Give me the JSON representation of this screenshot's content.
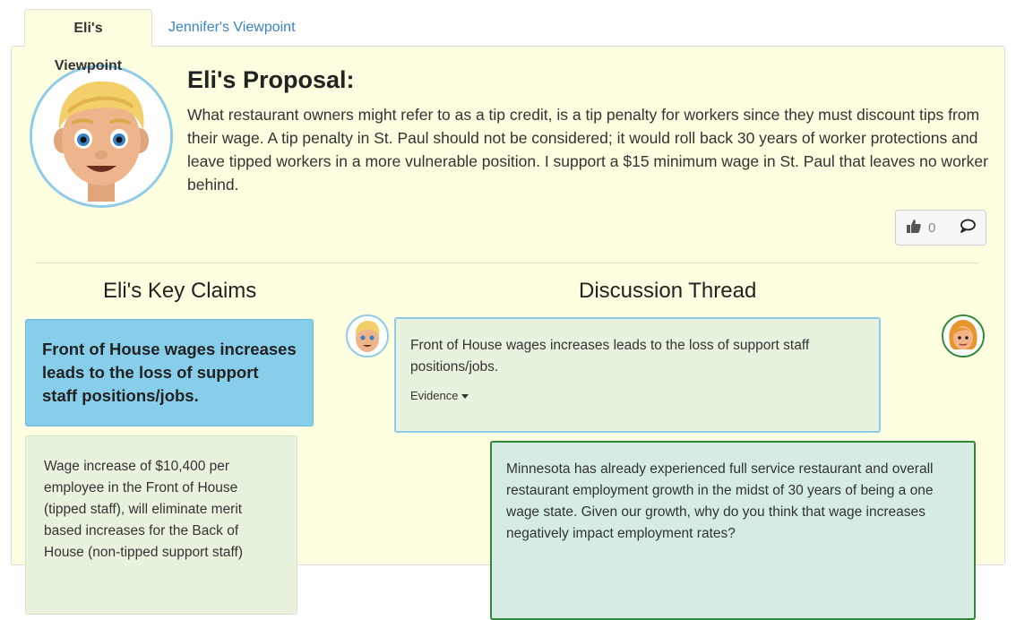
{
  "tabs": [
    {
      "label": "Eli's Viewpoint",
      "active": true
    },
    {
      "label": "Jennifer's Viewpoint",
      "active": false
    }
  ],
  "proposal": {
    "title": "Eli's Proposal:",
    "text": "What restaurant owners might refer to as a tip credit, is a tip penalty for workers since they must discount tips from their wage. A tip penalty in St. Paul should not be considered; it would roll back 30 years of worker protections and leave tipped workers in a more vulnerable position. I support a $15 minimum wage in St. Paul that leaves no worker behind.",
    "likes": "0",
    "avatar_icon": "blond-man-emoji-icon"
  },
  "claims": {
    "title": "Eli's Key Claims",
    "main": "Front of House wages increases leads to the loss of support staff positions/jobs.",
    "sub": "Wage increase of $10,400 per employee in the Front of House (tipped staff), will eliminate merit based increases for the Back of House (non-tipped support staff)"
  },
  "thread": {
    "title": "Discussion Thread",
    "messages": [
      {
        "author": "Eli",
        "text": "Front of House wages increases leads to the loss of support staff positions/jobs.",
        "evidence_label": "Evidence"
      },
      {
        "author": "Jennifer",
        "text": "Minnesota has already experienced full service restaurant and overall restaurant employment growth in the midst of 30 years of being a one wage state. Given our growth, why do you think that wage increases negatively impact employment rates?"
      }
    ]
  },
  "colors": {
    "panel_bg": "#fefee0",
    "claim_main": "#87ceeb",
    "eli_border": "#8ecbe8",
    "jennifer_border": "#2f8a38",
    "link": "#3a84c7"
  }
}
